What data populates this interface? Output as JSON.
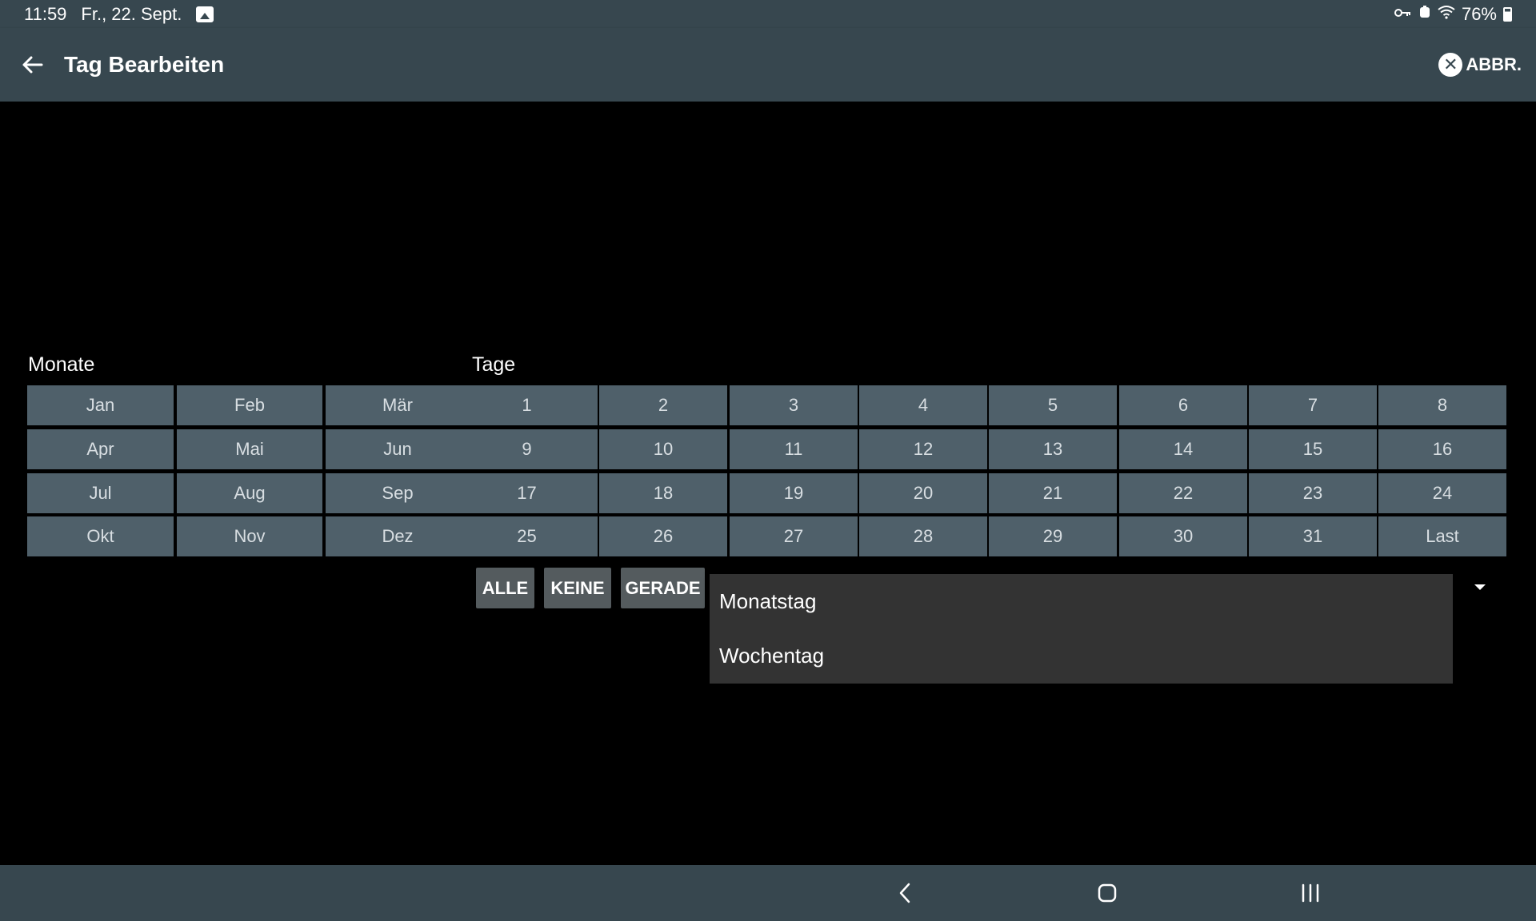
{
  "status_bar": {
    "time": "11:59",
    "date": "Fr., 22. Sept.",
    "battery": "76%"
  },
  "app_bar": {
    "title": "Tag Bearbeiten",
    "cancel_label": "ABBR."
  },
  "labels": {
    "months": "Monate",
    "days": "Tage"
  },
  "months": [
    [
      "Jan",
      "Feb",
      "Mär"
    ],
    [
      "Apr",
      "Mai",
      "Jun"
    ],
    [
      "Jul",
      "Aug",
      "Sep"
    ],
    [
      "Okt",
      "Nov",
      "Dez"
    ]
  ],
  "days": [
    [
      "1",
      "2",
      "3",
      "4",
      "5",
      "6",
      "7",
      "8"
    ],
    [
      "9",
      "10",
      "11",
      "12",
      "13",
      "14",
      "15",
      "16"
    ],
    [
      "17",
      "18",
      "19",
      "20",
      "21",
      "22",
      "23",
      "24"
    ],
    [
      "25",
      "26",
      "27",
      "28",
      "29",
      "30",
      "31",
      "Last"
    ]
  ],
  "buttons": {
    "all": "ALLE",
    "none": "KEINE",
    "even": "GERADE"
  },
  "dropdown": {
    "options": [
      "Monatstag",
      "Wochentag"
    ]
  },
  "colors": {
    "bar": "#37474f",
    "cell": "#4f606a",
    "button": "#545b5e",
    "dropdown": "#333333"
  }
}
